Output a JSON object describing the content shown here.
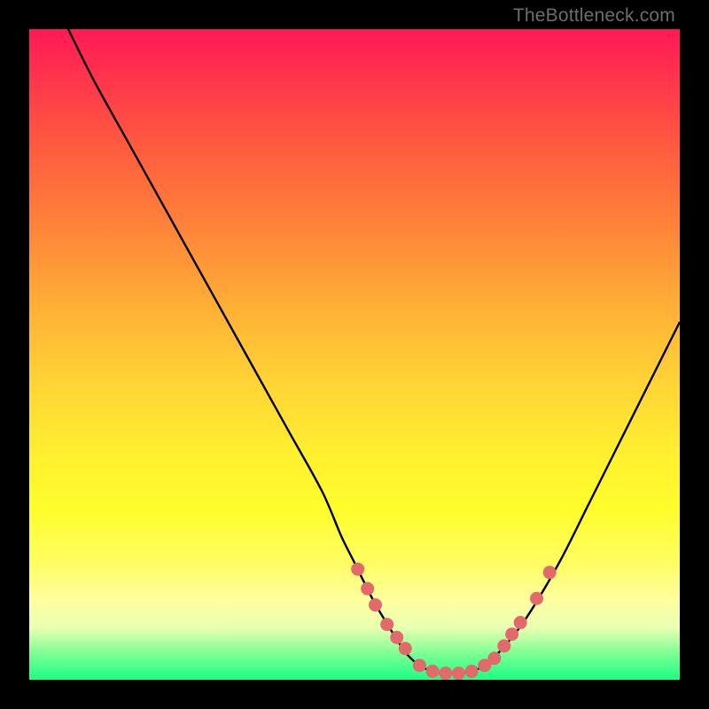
{
  "watermark": {
    "text": "TheBottleneck.com"
  },
  "colors": {
    "curve_stroke": "#000000",
    "point_fill": "#e26a6a",
    "point_stroke": "#e26a6a"
  },
  "chart_data": {
    "type": "line",
    "title": "",
    "xlabel": "",
    "ylabel": "",
    "xlim": [
      0,
      100
    ],
    "ylim": [
      0,
      100
    ],
    "grid": false,
    "legend": false,
    "series": [
      {
        "name": "bottleneck-curve",
        "x": [
          6,
          10,
          15,
          20,
          25,
          30,
          35,
          40,
          45,
          48,
          50,
          53,
          56,
          58,
          60,
          62,
          64,
          66,
          68,
          70,
          72,
          75,
          78,
          82,
          86,
          90,
          95,
          100
        ],
        "y": [
          100,
          92,
          83,
          74,
          65,
          56,
          47,
          38,
          29,
          22,
          18,
          12,
          7,
          4,
          2.2,
          1.3,
          1.0,
          1.0,
          1.3,
          2.2,
          4,
          7.5,
          12,
          19,
          27,
          35,
          45,
          55
        ]
      }
    ],
    "points": {
      "name": "highlighted-points",
      "x": [
        50.5,
        52.0,
        53.2,
        55.0,
        56.5,
        57.8,
        60.0,
        62.0,
        64.0,
        66.0,
        68.0,
        70.0,
        71.5,
        73.0,
        74.2,
        75.5,
        78.0,
        80.0
      ],
      "y": [
        17.0,
        14.0,
        11.5,
        8.5,
        6.5,
        4.8,
        2.2,
        1.3,
        1.0,
        1.0,
        1.3,
        2.2,
        3.3,
        5.2,
        7.0,
        8.8,
        12.5,
        16.5
      ]
    }
  }
}
